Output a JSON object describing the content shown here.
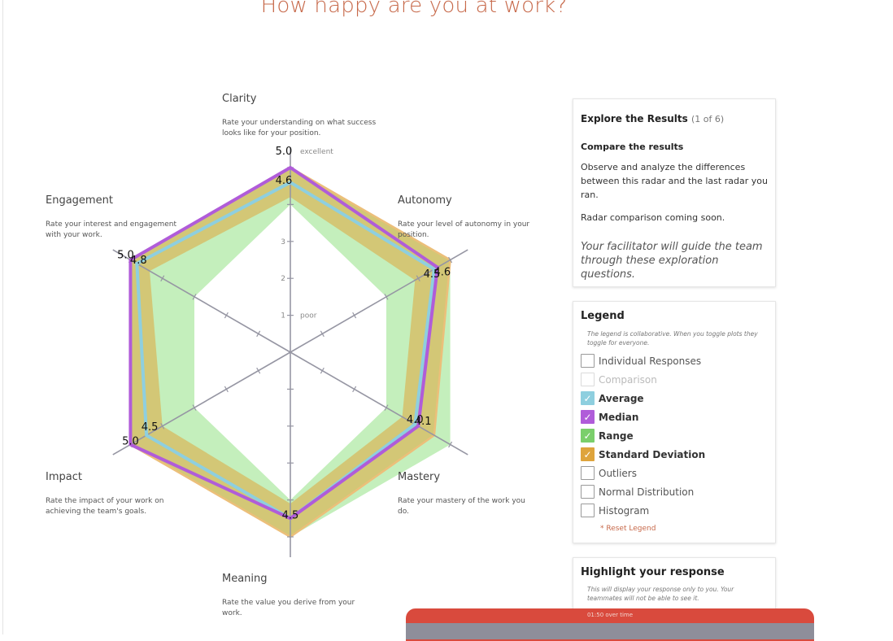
{
  "title": "How happy are you at work?",
  "dimensions": [
    {
      "name": "Clarity",
      "desc": "Rate your understanding on what success looks like for your position."
    },
    {
      "name": "Autonomy",
      "desc": "Rate your level of autonomy in your position."
    },
    {
      "name": "Mastery",
      "desc": "Rate your mastery of the work you do."
    },
    {
      "name": "Meaning",
      "desc": "Rate the value you derive from your work."
    },
    {
      "name": "Impact",
      "desc": "Rate the impact of your work on achieving the team's goals."
    },
    {
      "name": "Engagement",
      "desc": "Rate your interest and engagement with your work."
    }
  ],
  "chart_data": {
    "type": "radar",
    "axes": [
      "Clarity",
      "Autonomy",
      "Mastery",
      "Meaning",
      "Impact",
      "Engagement"
    ],
    "scale": {
      "min": 0,
      "max": 5,
      "ticks": [
        1,
        2,
        3,
        4,
        5
      ]
    },
    "scale_labels": {
      "1": "poor",
      "5": "excellent"
    },
    "tick_labels": [
      "1",
      "2",
      "3"
    ],
    "series": [
      {
        "name": "Range",
        "color": "#c4efbc",
        "min": [
          4.0,
          3.0,
          3.0,
          4.0,
          3.0,
          3.0
        ],
        "max": [
          5.0,
          5.0,
          5.0,
          5.0,
          5.0,
          5.0
        ]
      },
      {
        "name": "Standard Deviation",
        "color": "#d4c472",
        "lower": [
          4.2,
          3.9,
          3.5,
          4.1,
          4.0,
          4.4
        ],
        "upper": [
          5.0,
          5.0,
          4.5,
          5.0,
          5.0,
          5.0
        ]
      },
      {
        "name": "Average",
        "color": "#8ecfdf",
        "values": [
          4.6,
          4.5,
          3.9,
          4.5,
          4.5,
          4.8
        ]
      },
      {
        "name": "Median",
        "color": "#b05cd9",
        "values": [
          5.0,
          4.6,
          4.0,
          4.5,
          5.0,
          5.0
        ]
      }
    ],
    "value_labels": [
      {
        "axis": 0,
        "text": "5.0",
        "value": 5.0
      },
      {
        "axis": 0,
        "text": "4.6",
        "value": 4.6
      },
      {
        "axis": 1,
        "text": "4.6",
        "value": 4.6
      },
      {
        "axis": 1,
        "text": "4.5",
        "value": 4.5
      },
      {
        "axis": 2,
        "text": "4.0",
        "value": 4.0
      },
      {
        "axis": 2,
        "text": "4.1",
        "value": 4.1
      },
      {
        "axis": 3,
        "text": "4.5",
        "value": 4.5
      },
      {
        "axis": 4,
        "text": "5.0",
        "value": 5.0
      },
      {
        "axis": 4,
        "text": "4.5",
        "value": 4.5
      },
      {
        "axis": 5,
        "text": "5.0",
        "value": 5.0
      },
      {
        "axis": 5,
        "text": "4.8",
        "value": 4.8
      }
    ]
  },
  "explore": {
    "title": "Explore the Results",
    "count": "(1 of 6)",
    "subtitle": "Compare the results",
    "body": "Observe and analyze the differences between this radar and the last radar you ran.",
    "coming_soon": "Radar comparison coming soon.",
    "note": "Your facilitator will guide the team through these exploration questions."
  },
  "legend": {
    "title": "Legend",
    "subtitle": "The legend is collaborative. When you toggle plots they toggle for everyone.",
    "items": [
      {
        "label": "Individual Responses",
        "checked": false,
        "color": ""
      },
      {
        "label": "Comparison",
        "checked": false,
        "color": "",
        "faint": true
      },
      {
        "label": "Average",
        "checked": true,
        "color": "#8ecfdf"
      },
      {
        "label": "Median",
        "checked": true,
        "color": "#b05cd9"
      },
      {
        "label": "Range",
        "checked": true,
        "color": "#7bcf6b"
      },
      {
        "label": "Standard Deviation",
        "checked": true,
        "color": "#dea43c"
      },
      {
        "label": "Outliers",
        "checked": false,
        "color": ""
      },
      {
        "label": "Normal Distribution",
        "checked": false,
        "color": ""
      },
      {
        "label": "Histogram",
        "checked": false,
        "color": ""
      }
    ],
    "reset": "* Reset Legend"
  },
  "highlight": {
    "title": "Highlight your response",
    "subtitle": "This will display your response only to you. Your teammates will not be able to see it."
  },
  "timer": {
    "text": "01:50 over time"
  }
}
